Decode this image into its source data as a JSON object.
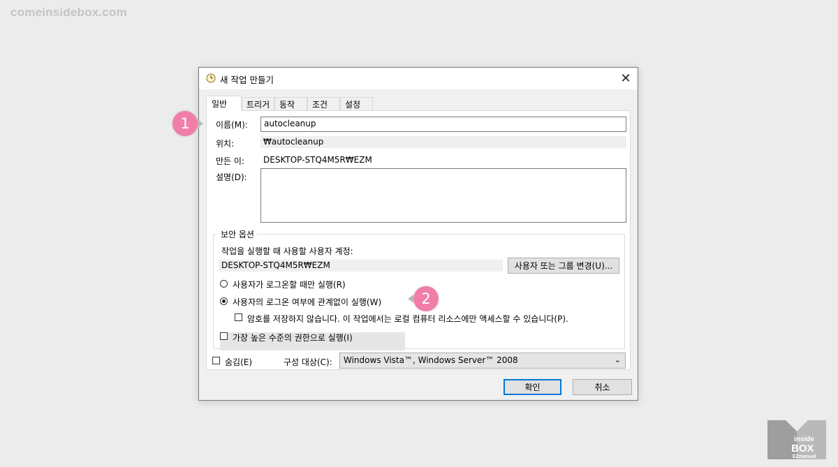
{
  "watermark": "comeinsidebox.com",
  "dialog": {
    "title": "새 작업 만들기",
    "close_label": "✕"
  },
  "tabs": [
    {
      "label": "일반",
      "active": true
    },
    {
      "label": "트리거",
      "active": false
    },
    {
      "label": "동작",
      "active": false
    },
    {
      "label": "조건",
      "active": false
    },
    {
      "label": "설정",
      "active": false
    }
  ],
  "general": {
    "name_label": "이름(M):",
    "name_value": "autocleanup",
    "location_label": "위치:",
    "location_value": "₩autocleanup",
    "author_label": "만든 이:",
    "author_value": "DESKTOP-STQ4M5R₩EZM",
    "description_label": "설명(D):",
    "description_value": ""
  },
  "security": {
    "group_title": "보안 옵션",
    "account_prompt": "작업을 실행할 때 사용할 사용자 계정:",
    "account_value": "DESKTOP-STQ4M5R₩EZM",
    "change_button": "사용자 또는 그룹 변경(U)...",
    "radio_logged_on": "사용자가 로그온할 때만 실행(R)",
    "radio_regardless": "사용자의 로그온 여부에 관계없이 실행(W)",
    "dont_store_password": "암호를 저장하지 않습니다. 이 작업에서는 로컬 컴퓨터 리소스에만 액세스할 수 있습니다(P).",
    "highest_privileges": "가장 높은 수준의 권한으로 실행(I)"
  },
  "footer": {
    "hidden_label": "숨김(E)",
    "configure_label": "구성 대상(C):",
    "configure_value": "Windows Vista™, Windows Server™ 2008",
    "ok_button": "확인",
    "cancel_button": "취소"
  },
  "annotations": {
    "badge1": "1",
    "badge2": "2"
  },
  "logo": {
    "line1": "inside",
    "line2": "BOX",
    "line3": "EZmanual"
  },
  "colors": {
    "badge": "#f17ea8",
    "primary_border": "#0078d7"
  }
}
